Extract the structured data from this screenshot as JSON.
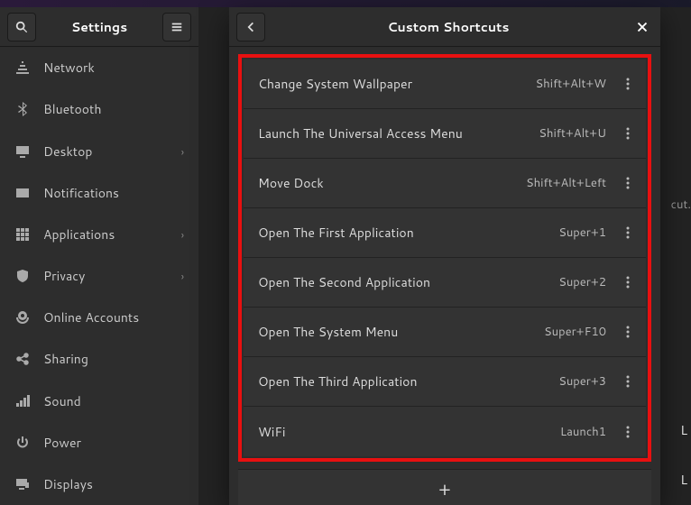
{
  "settings_title": "Settings",
  "dialog_title": "Custom Shortcuts",
  "bg_hint_tail": "cut.",
  "bg_letter": "L",
  "add_label": "+",
  "sidebar": {
    "items": [
      {
        "label": "Network",
        "icon": "network-icon",
        "chevron": false
      },
      {
        "label": "Bluetooth",
        "icon": "bluetooth-icon",
        "chevron": false
      },
      {
        "label": "Desktop",
        "icon": "desktop-icon",
        "chevron": true
      },
      {
        "label": "Notifications",
        "icon": "notifications-icon",
        "chevron": false
      },
      {
        "label": "Applications",
        "icon": "applications-icon",
        "chevron": true
      },
      {
        "label": "Privacy",
        "icon": "privacy-icon",
        "chevron": true
      },
      {
        "label": "Online Accounts",
        "icon": "online-accounts-icon",
        "chevron": false
      },
      {
        "label": "Sharing",
        "icon": "sharing-icon",
        "chevron": false
      },
      {
        "label": "Sound",
        "icon": "sound-icon",
        "chevron": false
      },
      {
        "label": "Power",
        "icon": "power-icon",
        "chevron": false
      },
      {
        "label": "Displays",
        "icon": "displays-icon",
        "chevron": false
      }
    ]
  },
  "shortcuts": [
    {
      "name": "Change System Wallpaper",
      "keys": "Shift+Alt+W"
    },
    {
      "name": "Launch The Universal Access Menu",
      "keys": "Shift+Alt+U"
    },
    {
      "name": "Move Dock",
      "keys": "Shift+Alt+Left"
    },
    {
      "name": "Open The First Application",
      "keys": "Super+1"
    },
    {
      "name": "Open The Second Application",
      "keys": "Super+2"
    },
    {
      "name": "Open The System Menu",
      "keys": "Super+F10"
    },
    {
      "name": "Open The Third Application",
      "keys": "Super+3"
    },
    {
      "name": "WiFi",
      "keys": "Launch1"
    }
  ]
}
